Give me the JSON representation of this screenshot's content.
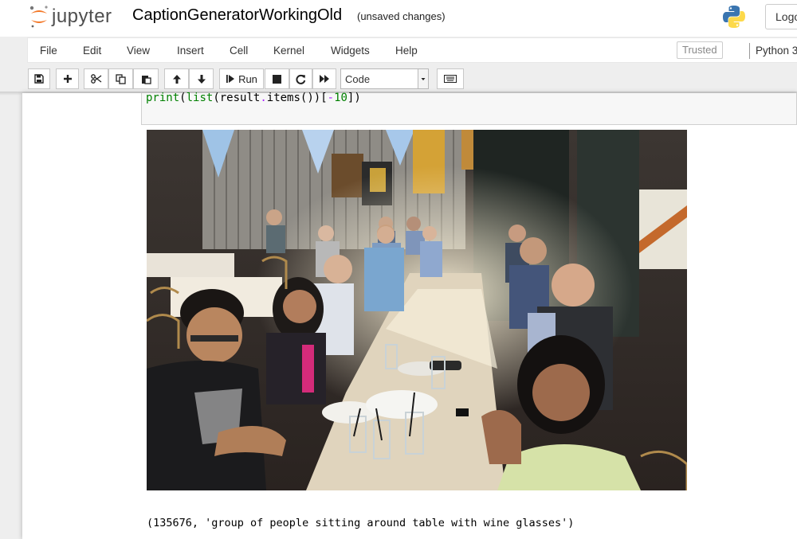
{
  "header": {
    "logo_text": "jupyter",
    "notebook_name": "CaptionGeneratorWorkingOld",
    "save_status": "(unsaved changes)",
    "logout_label": "Logout",
    "python_icon": "python-logo-icon"
  },
  "menubar": {
    "items": [
      "File",
      "Edit",
      "View",
      "Insert",
      "Cell",
      "Kernel",
      "Widgets",
      "Help"
    ],
    "trusted_label": "Trusted",
    "kernel_label": "Python 3"
  },
  "toolbar": {
    "buttons": [
      "save-icon",
      "plus-icon",
      "cut-icon",
      "copy-icon",
      "paste-icon",
      "arrow-up-icon",
      "arrow-down-icon",
      "run-icon",
      "stop-icon",
      "restart-icon",
      "fast-forward-icon",
      "keyboard-icon"
    ],
    "run_label": "Run",
    "cell_type": "Code"
  },
  "cell": {
    "code_tokens": [
      {
        "t": "print",
        "c": "kw"
      },
      {
        "t": "(",
        "c": "plain"
      },
      {
        "t": "list",
        "c": "kw"
      },
      {
        "t": "(result",
        "c": "plain"
      },
      {
        "t": ".",
        "c": "op"
      },
      {
        "t": "items())[",
        "c": "plain"
      },
      {
        "t": "-",
        "c": "op"
      },
      {
        "t": "10",
        "c": "num"
      },
      {
        "t": "])",
        "c": "plain"
      }
    ],
    "output_image": "group-photo",
    "output_text": "(135676, 'group of people sitting around table with wine glasses')"
  },
  "colors": {
    "jupyter_orange": "#f37726",
    "code_keyword": "#008000",
    "code_operator": "#aa22ff"
  }
}
